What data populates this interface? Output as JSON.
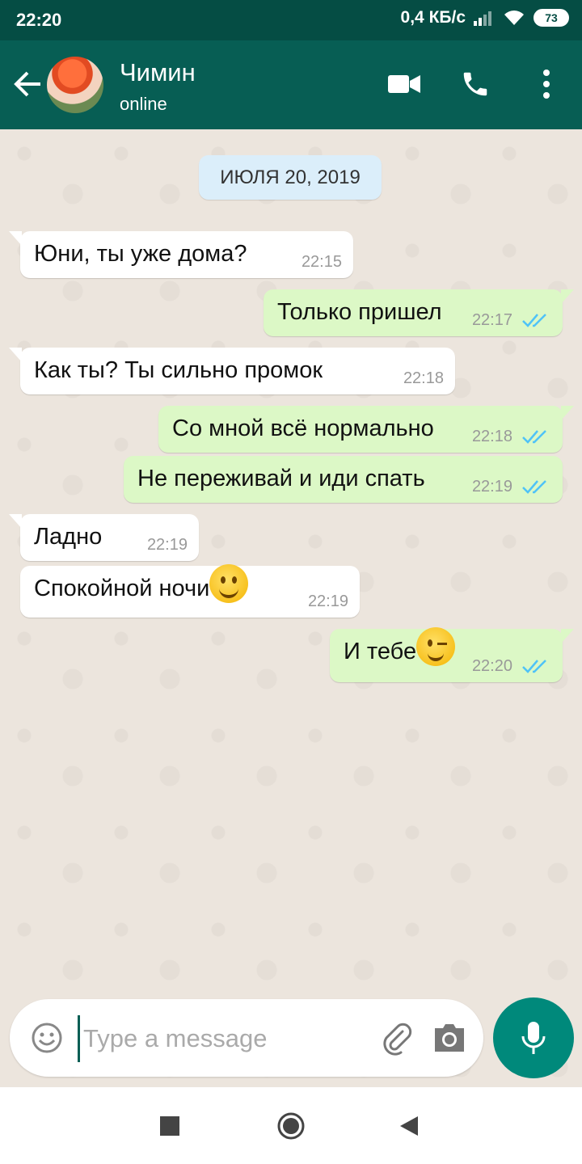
{
  "status_bar": {
    "time": "22:20",
    "speed": "0,4 КБ/с",
    "battery": "73"
  },
  "header": {
    "contact_name": "Чимин",
    "contact_status": "online"
  },
  "chat": {
    "date": "ИЮЛЯ 20, 2019",
    "messages": [
      {
        "direction": "in",
        "text": "Юни, ты уже дома?",
        "time": "22:15"
      },
      {
        "direction": "out",
        "text": "Только пришел",
        "time": "22:17",
        "read": true
      },
      {
        "direction": "in",
        "text": "Как ты? Ты сильно промок",
        "time": "22:18"
      },
      {
        "direction": "out",
        "text": "Со мной всё нормально",
        "time": "22:18",
        "read": true
      },
      {
        "direction": "out",
        "text": "Не переживай и иди спать",
        "time": "22:19",
        "read": true
      },
      {
        "direction": "in",
        "text": "Ладно",
        "time": "22:19"
      },
      {
        "direction": "in",
        "text": "Спокойной ночи",
        "emoji": "smiling-face",
        "time": "22:19"
      },
      {
        "direction": "out",
        "text": "И тебе",
        "emoji": "winking-face",
        "time": "22:20",
        "read": true
      }
    ]
  },
  "composer": {
    "placeholder": "Type a message"
  },
  "colors": {
    "header": "#075e54",
    "status_bar": "#054d44",
    "outgoing_bubble": "#dcf8c6",
    "incoming_bubble": "#ffffff",
    "read_ticks": "#4fc3f7",
    "mic_button": "#00897b"
  }
}
